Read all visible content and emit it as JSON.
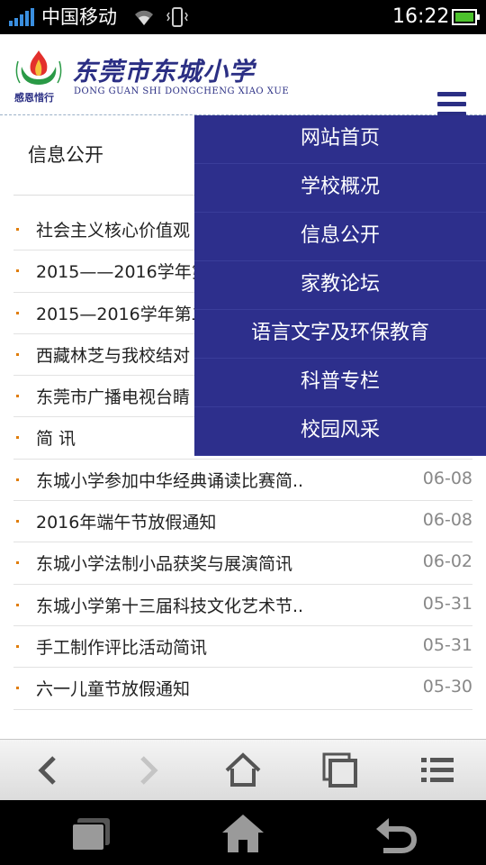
{
  "status_bar": {
    "carrier": "中国移动",
    "time": "16:22",
    "icons": [
      "signal-icon",
      "wifi-icon",
      "vibrate-icon",
      "battery-icon"
    ]
  },
  "header": {
    "school_name": "东莞市东城小学",
    "school_name_en": "DONG GUAN SHI DONGCHENG XIAO XUE",
    "motto": "感恩惜行",
    "menu_icon": "hamburger-icon",
    "brand_color": "#2b2f84"
  },
  "section": {
    "title": "信息公开"
  },
  "news": [
    {
      "title": "社会主义核心价值观",
      "date": ""
    },
    {
      "title": "2015——2016学年第",
      "date": ""
    },
    {
      "title": "2015—2016学年第二",
      "date": ""
    },
    {
      "title": "西藏林芝与我校结对",
      "date": ""
    },
    {
      "title": "东莞市广播电视台睛",
      "date": ""
    },
    {
      "title": "简 讯",
      "date": ""
    },
    {
      "title": "东城小学参加中华经典诵读比赛简..",
      "date": "06-08"
    },
    {
      "title": "2016年端午节放假通知",
      "date": "06-08"
    },
    {
      "title": "东城小学法制小品获奖与展演简讯",
      "date": "06-02"
    },
    {
      "title": "东城小学第十三届科技文化艺术节..",
      "date": "05-31"
    },
    {
      "title": "手工制作评比活动简讯",
      "date": "05-31"
    },
    {
      "title": "六一儿童节放假通知",
      "date": "05-30"
    }
  ],
  "dropdown_nav": {
    "background": "#2d2f8c",
    "items": [
      "网站首页",
      "学校概况",
      "信息公开",
      "家教论坛",
      "语言文字及环保教育",
      "科普专栏",
      "校园风采"
    ]
  },
  "browser_toolbar": {
    "buttons": [
      "back-icon",
      "forward-icon",
      "home-icon",
      "windows-icon",
      "menu-list-icon"
    ]
  },
  "system_nav": {
    "buttons": [
      "recent-apps-icon",
      "home-icon",
      "back-icon"
    ]
  }
}
